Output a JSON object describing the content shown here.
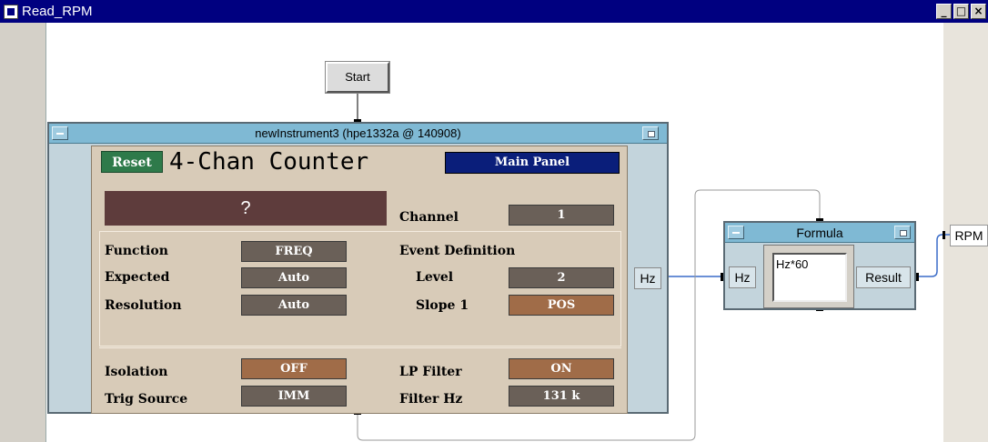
{
  "window": {
    "title": "Read_RPM",
    "buttons": [
      "_",
      "□",
      "×"
    ]
  },
  "start_button": {
    "label": "Start"
  },
  "instrument": {
    "title": "newInstrument3 (hpe1332a @ 140908)",
    "reset_label": "Reset",
    "panel_title": "4-Chan Counter",
    "main_panel_label": "Main Panel",
    "display_value": "?",
    "output_port": "Hz",
    "fields": {
      "channel": {
        "label": "Channel",
        "value": "1"
      },
      "function": {
        "label": "Function",
        "value": "FREQ"
      },
      "expected": {
        "label": "Expected",
        "value": "Auto"
      },
      "resolution": {
        "label": "Resolution",
        "value": "Auto"
      },
      "event_definition": {
        "label": "Event Definition"
      },
      "level": {
        "label": "Level",
        "value": "2"
      },
      "slope": {
        "label": "Slope 1",
        "value": "POS"
      },
      "isolation": {
        "label": "Isolation",
        "value": "OFF"
      },
      "trig_source": {
        "label": "Trig Source",
        "value": "IMM"
      },
      "lp_filter": {
        "label": "LP Filter",
        "value": "ON"
      },
      "filter_hz": {
        "label": "Filter Hz",
        "value": "131 k"
      }
    }
  },
  "formula": {
    "title": "Formula",
    "input_port": "Hz",
    "expression": "Hz*60",
    "output_port": "Result"
  },
  "rpm_output": {
    "label": "RPM"
  },
  "colors": {
    "title_bar": "#000080",
    "object_title": "#7fb9d4",
    "panel_bg": "#d8cbb8",
    "reset_green": "#2e7a4a",
    "main_panel_blue": "#0a1e7a",
    "value_dark": "#6a6058",
    "value_orange": "#a06c48",
    "wire": "#3a6cc8"
  }
}
